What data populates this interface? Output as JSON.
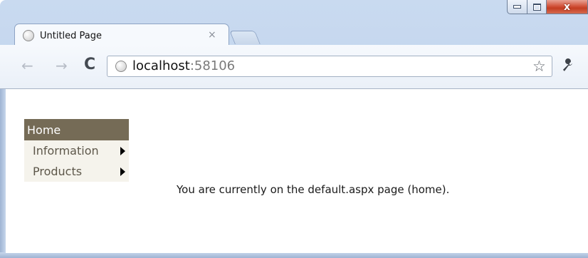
{
  "browser": {
    "tab": {
      "title": "Untitled Page",
      "close_glyph": "×",
      "favicon": "globe-icon"
    },
    "nav": {
      "back_glyph": "←",
      "forward_glyph": "→",
      "reload_glyph": "C"
    },
    "address": {
      "host": "localhost",
      "port": ":58106",
      "page_icon": "globe-icon"
    },
    "star_glyph": "☆",
    "wrench_glyph": "🔧",
    "window_controls": {
      "close_glyph": "x"
    }
  },
  "page": {
    "menu": {
      "items": [
        {
          "label": "Home",
          "selected": true,
          "has_submenu": false
        },
        {
          "label": "Information",
          "selected": false,
          "has_submenu": true
        },
        {
          "label": "Products",
          "selected": false,
          "has_submenu": true
        }
      ]
    },
    "message": "You are currently on the default.aspx page (home)."
  },
  "colors": {
    "menu_selected_bg": "#756b56",
    "menu_item_bg": "#f5f3ec",
    "menu_item_text": "#5d574a"
  }
}
